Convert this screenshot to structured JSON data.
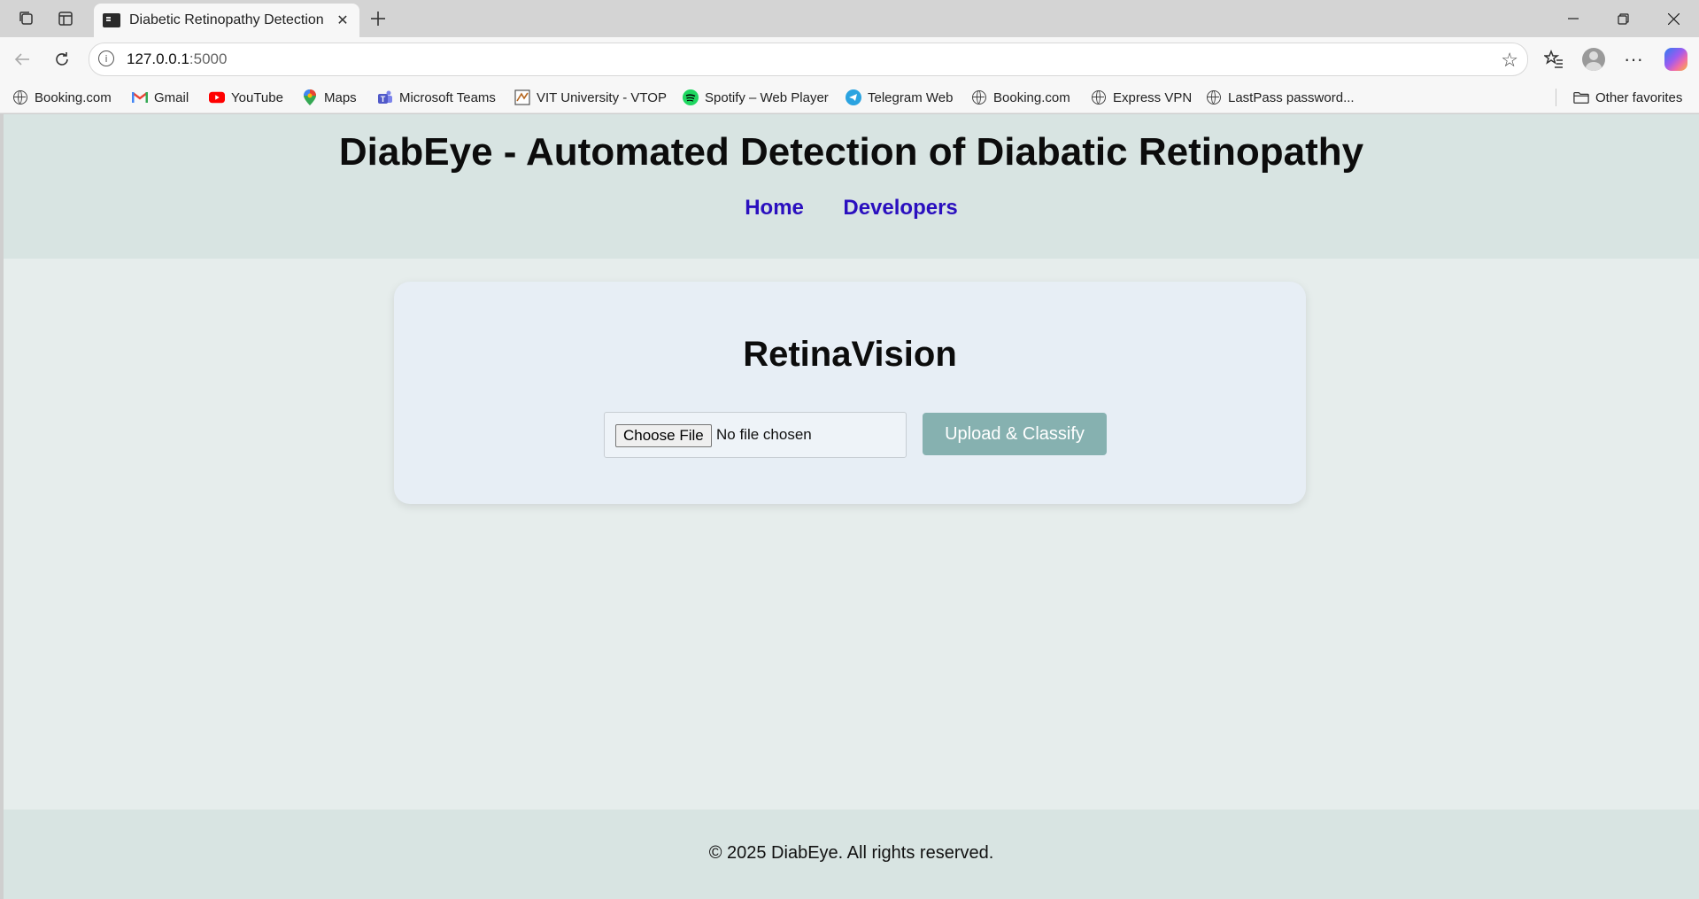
{
  "browser": {
    "tab_title": "Diabetic Retinopathy Detection",
    "url_host": "127.0.0.1",
    "url_port": ":5000",
    "bookmarks": [
      {
        "label": "Booking.com",
        "icon": "globe-icon"
      },
      {
        "label": "Gmail",
        "icon": "gmail-icon"
      },
      {
        "label": "YouTube",
        "icon": "youtube-icon"
      },
      {
        "label": "Maps",
        "icon": "maps-icon"
      },
      {
        "label": "Microsoft Teams",
        "icon": "teams-icon"
      },
      {
        "label": "VIT University - VTOP",
        "icon": "vtop-icon"
      },
      {
        "label": "Spotify – Web Player",
        "icon": "spotify-icon"
      },
      {
        "label": "Telegram Web",
        "icon": "telegram-icon"
      },
      {
        "label": "Booking.com",
        "icon": "globe-icon"
      },
      {
        "label": "Express VPN",
        "icon": "globe-icon"
      },
      {
        "label": "LastPass password...",
        "icon": "globe-icon"
      }
    ],
    "other_favorites": "Other favorites"
  },
  "site": {
    "title": "DiabEye - Automated Detection of Diabatic Retinopathy",
    "nav": {
      "home": "Home",
      "developers": "Developers"
    }
  },
  "card": {
    "title": "RetinaVision",
    "choose_file": "Choose File",
    "file_status": "No file chosen",
    "upload_label": "Upload & Classify"
  },
  "footer": {
    "text": "© 2025 DiabEye. All rights reserved."
  },
  "colors": {
    "header_bg": "#d8e4e2",
    "nav_link": "#2a0fbf",
    "button_bg": "#86b1b0",
    "card_bg": "#e7eef5"
  }
}
